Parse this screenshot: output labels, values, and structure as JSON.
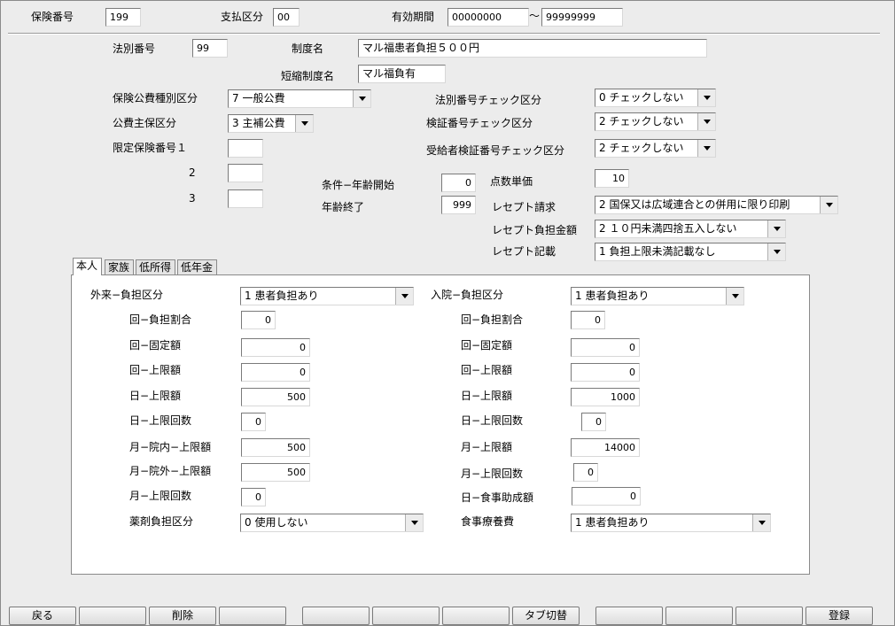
{
  "header": {
    "insurance_no_label": "保険番号",
    "insurance_no": "199",
    "payment_class_label": "支払区分",
    "payment_class": "00",
    "valid_period_label": "有効期間",
    "valid_from": "00000000",
    "tilde": "〜",
    "valid_to": "99999999"
  },
  "main": {
    "law_no_label": "法別番号",
    "law_no": "99",
    "system_name_label": "制度名",
    "system_name": "マル福患者負担５００円",
    "short_name_label": "短縮制度名",
    "short_name": "マル福負有",
    "public_type_label": "保険公費種別区分",
    "public_type": "7 一般公費",
    "public_main_label": "公費主保区分",
    "public_main": "3 主補公費",
    "limited_label": "限定保険番号１",
    "limited_1": "",
    "limited_2_label": "2",
    "limited_2": "",
    "limited_3_label": "3",
    "limited_3": "",
    "law_check_label": "法別番号チェック区分",
    "law_check": "0 チェックしない",
    "verify_check_label": "検証番号チェック区分",
    "verify_check": "2 チェックしない",
    "recipient_check_label": "受給者検証番号チェック区分",
    "recipient_check": "2 チェックしない",
    "age_start_label": "条件−年齢開始",
    "age_start": "0",
    "age_end_label": "年齢終了",
    "age_end": "999",
    "point_price_label": "点数単価",
    "point_price": "10",
    "receipt_claim_label": "レセプト請求",
    "receipt_claim": "2 国保又は広域連合との併用に限り印刷",
    "receipt_amount_label": "レセプト負担金額",
    "receipt_amount": "2 １０円未満四捨五入しない",
    "receipt_note_label": "レセプト記載",
    "receipt_note": "1 負担上限未満記載なし"
  },
  "tabs": [
    {
      "label": "本人"
    },
    {
      "label": "家族"
    },
    {
      "label": "低所得"
    },
    {
      "label": "低年金"
    }
  ],
  "outpatient": {
    "title": "外来−負担区分",
    "burden": "1 患者負担あり",
    "rate_label": "回−負担割合",
    "rate": "0",
    "fixed_label": "回−固定額",
    "fixed": "0",
    "visit_cap_label": "回−上限額",
    "visit_cap": "0",
    "day_cap_label": "日−上限額",
    "day_cap": "500",
    "day_count_label": "日−上限回数",
    "day_count": "0",
    "month_in_label": "月−院内−上限額",
    "month_in": "500",
    "month_out_label": "月−院外−上限額",
    "month_out": "500",
    "month_count_label": "月−上限回数",
    "month_count": "0",
    "drug_label": "薬剤負担区分",
    "drug": "0 使用しない"
  },
  "inpatient": {
    "title": "入院−負担区分",
    "burden": "1 患者負担あり",
    "rate_label": "回−負担割合",
    "rate": "0",
    "fixed_label": "回−固定額",
    "fixed": "0",
    "visit_cap_label": "回−上限額",
    "visit_cap": "0",
    "day_cap_label": "日−上限額",
    "day_cap": "1000",
    "day_count_label": "日−上限回数",
    "day_count": "0",
    "month_cap_label": "月−上限額",
    "month_cap": "14000",
    "month_count_label": "月−上限回数",
    "month_count": "0",
    "meal_aid_label": "日−食事助成額",
    "meal_aid": "0",
    "meal_label": "食事療養費",
    "meal": "1 患者負担あり"
  },
  "footer": {
    "back": "戻る",
    "f2": "",
    "delete": "削除",
    "f4": "",
    "f5": "",
    "f6": "",
    "f7": "",
    "tab_switch": "タブ切替",
    "f9": "",
    "f10": "",
    "f11": "",
    "register": "登録"
  }
}
